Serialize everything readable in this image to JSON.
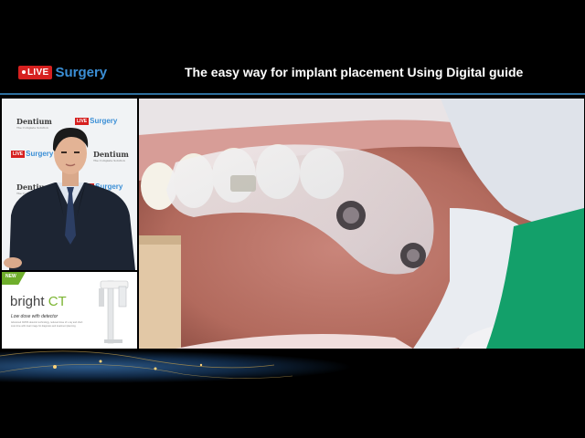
{
  "header": {
    "logo_badge": "LIVE",
    "logo_word": "Surgery",
    "title": "The easy way for implant placement Using Digital guide"
  },
  "backdrop": {
    "sponsor": "Dentium",
    "sponsor_tagline": "The Complete Solution",
    "live_badge": "LIVE",
    "live_word": "Surgery"
  },
  "ad": {
    "flag": "NEW",
    "brand_prefix": "bright",
    "brand_suffix": "CT",
    "tagline": "Low dose with detector",
    "description": "Advanced CMOS detector technology, reduced dose of x-ray and short scan time with clear image for diagnosis and treatment planning."
  },
  "colors": {
    "live_red": "#d6201f",
    "surgery_blue": "#3b8fd6",
    "ct_green": "#7bb531",
    "rule_blue": "#2f6f9e"
  }
}
